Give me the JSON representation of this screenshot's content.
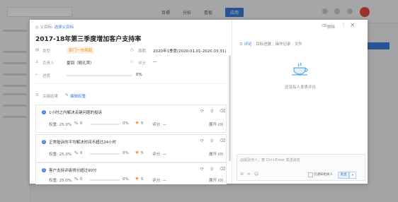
{
  "background": {
    "nav": [
      "目標",
      "分析",
      "看板",
      "应用"
    ],
    "active_nav": "应用"
  },
  "modal": {
    "parent_label": "父目标:",
    "parent_link": "选择父目标",
    "delete_label": "删除",
    "close_icon": "×",
    "title": "2017-18年第三季度增加客户支持率",
    "type_label": "类型",
    "type_value": "部门一市场部",
    "period_label": "周期",
    "period_value": "2020年1季度(2020.01.01-2020.03.31)",
    "owner_label": "负责人",
    "owner_value": "夏回（随孔萍）",
    "score_label": "评分",
    "score_value": "—",
    "progress_label": "进度",
    "progress_value": "0%",
    "kr_label": "关键结果",
    "kr_edit": "编辑权重",
    "key_results": [
      {
        "index": "1",
        "name": "1小时之内解决关键问题的投诉",
        "weight": "权重: 25.0%",
        "progress": "0",
        "percent": "0%",
        "likes": "5",
        "score": "评分: —",
        "expand": "展开 (0)"
      },
      {
        "index": "2",
        "name": "正常投诉的平均解决时间不超过24小时",
        "weight": "权重: 25.0%",
        "progress": "0",
        "percent": "0%",
        "likes": "5",
        "score": "评分: —",
        "expand": "展开 (0)"
      },
      {
        "index": "3",
        "name": "客户支持评级得分超过90分",
        "weight": "权重: 25.0%",
        "progress": "0",
        "percent": "0%",
        "likes": "5",
        "score": "评分: —",
        "expand": "展开 (0)"
      }
    ],
    "tabs": [
      "评论",
      "目标进展",
      "操作记录",
      "文件"
    ],
    "empty_text": "还没有人发表评论",
    "comment_placeholder": "@提及他人，按 Ctrl+Enter 发送消息",
    "notify_label": "仅通知相关人",
    "send_label": "发送"
  },
  "colors": {
    "accent": "#3b7ddd",
    "tag": "#f08a24"
  }
}
